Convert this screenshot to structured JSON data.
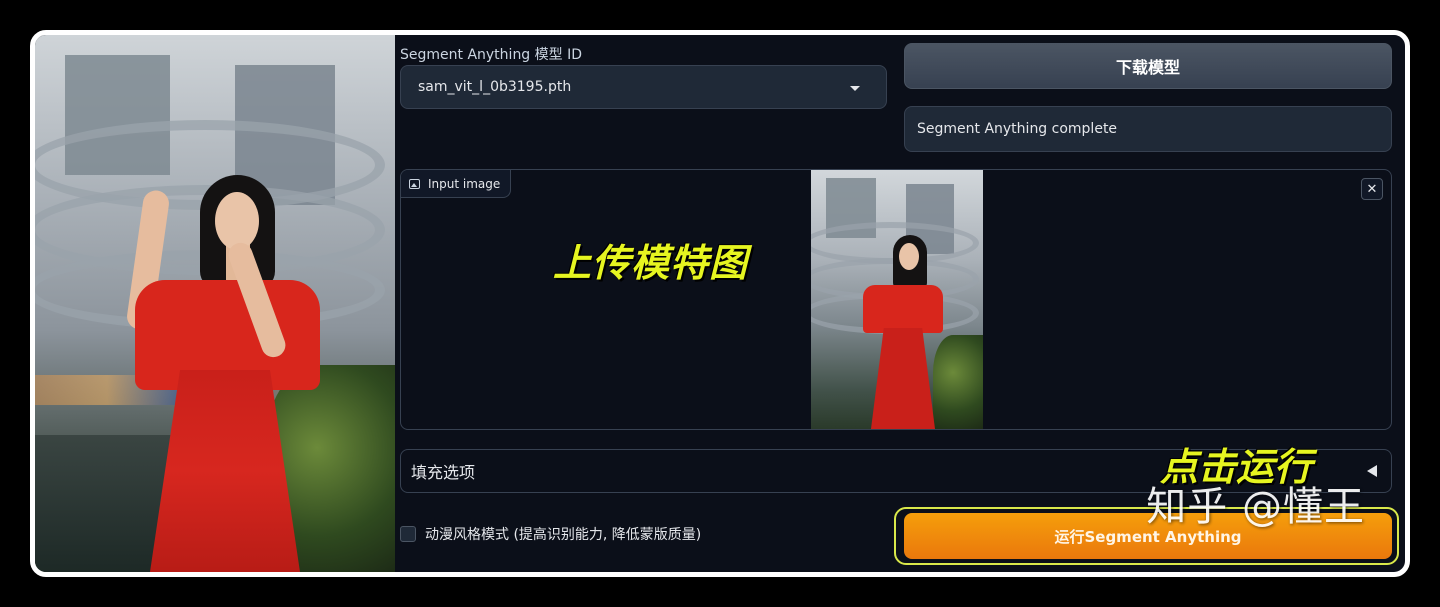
{
  "model": {
    "label": "Segment Anything 模型 ID",
    "selected": "sam_vit_l_0b3195.pth",
    "download_button": "下载模型",
    "status": "Segment Anything complete"
  },
  "input_image": {
    "tag_label": "Input image",
    "overlay_text": "上传模特图",
    "close_symbol": "✕"
  },
  "fill_options": {
    "label": "填充选项"
  },
  "overlay_run_text": "点击运行",
  "anime_mode": {
    "label": "动漫风格模式 (提高识别能力, 降低蒙版质量)"
  },
  "run_button": {
    "label": "运行Segment Anything"
  },
  "watermark": "知乎 @懂王",
  "colors": {
    "accent": "#f59e0b",
    "highlight": "#e6f520",
    "background": "#0b0f19",
    "panel": "#1f2937"
  }
}
